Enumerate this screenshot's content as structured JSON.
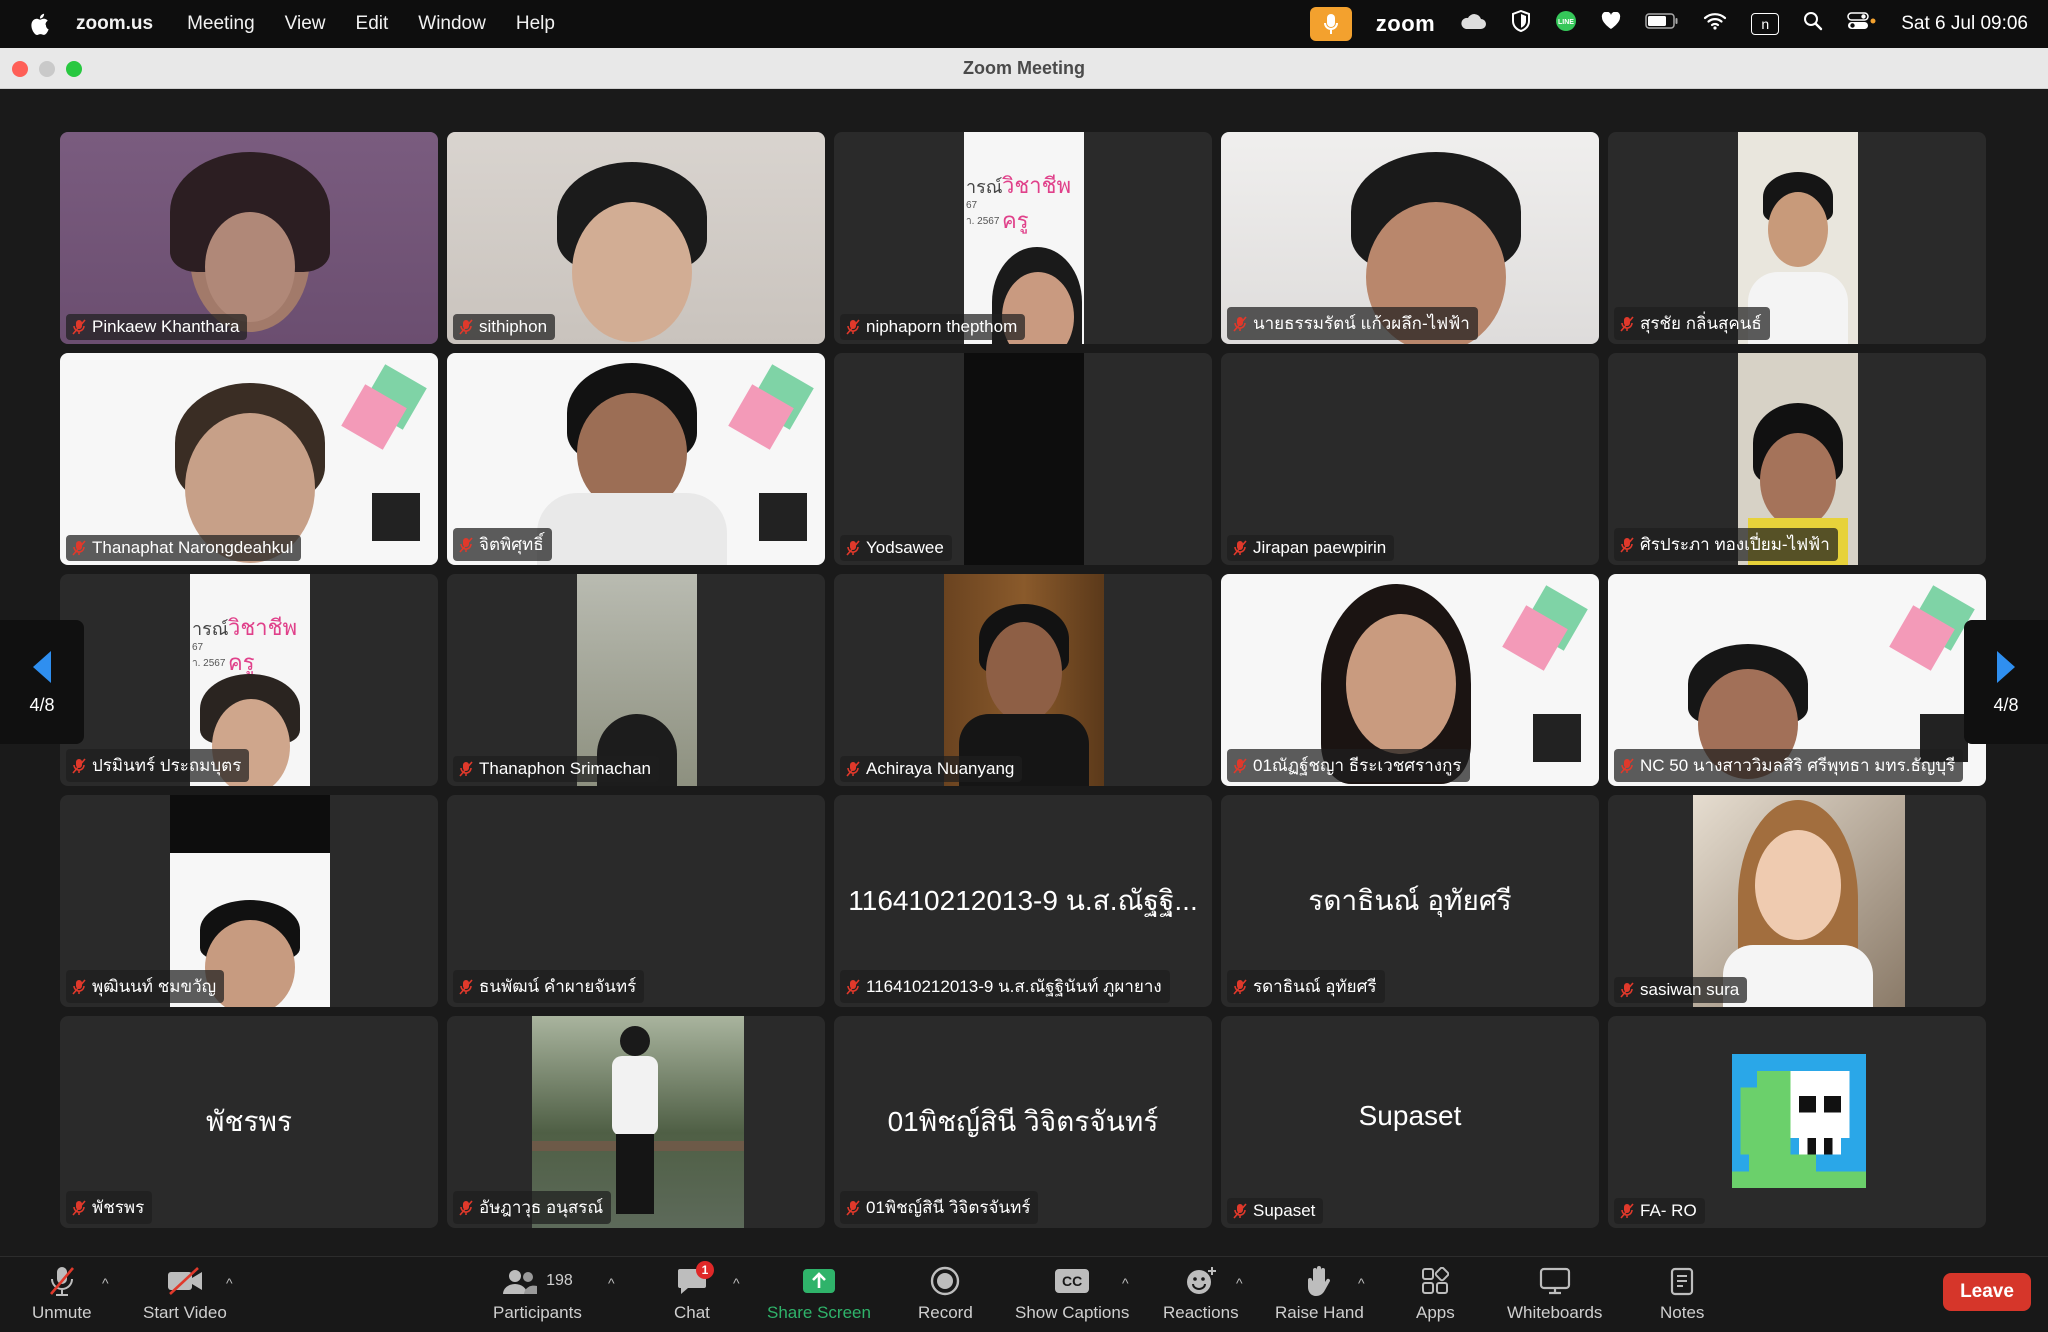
{
  "menubar": {
    "app": "zoom.us",
    "items": [
      "Meeting",
      "View",
      "Edit",
      "Window",
      "Help"
    ],
    "zoom_label": "zoom",
    "datetime": "Sat 6 Jul  09:06",
    "n_label": "n"
  },
  "window": {
    "title": "Zoom Meeting"
  },
  "pager": {
    "label": "4/8"
  },
  "participants": [
    {
      "name": "Pinkaew Khanthara"
    },
    {
      "name": "sithiphon"
    },
    {
      "name": "niphaporn thepthom"
    },
    {
      "name": "นายธรรมรัตน์ แก้วผลึก-ไฟฟ้า"
    },
    {
      "name": "สุรชัย กลิ่นสุคนธ์"
    },
    {
      "name": "Thanaphat Narongdeahkul"
    },
    {
      "name": "จิตพิศุทธิ์"
    },
    {
      "name": "Yodsawee"
    },
    {
      "name": "Jirapan paewpirin"
    },
    {
      "name": "ศิรประภา ทองเปี่ยม-ไฟฟ้า"
    },
    {
      "name": "ปรมินทร์ ประถมบุตร"
    },
    {
      "name": "Thanaphon Srimachan"
    },
    {
      "name": "Achiraya Nuanyang"
    },
    {
      "name": "01ณัฏฐ์ชญา ธีระเวชศรางกูร"
    },
    {
      "name": "NC 50 นางสาววิมลสิริ ศรีพุทธา มทร.ธัญบุรี"
    },
    {
      "name": "พุฒินนท์ ชมขวัญ"
    },
    {
      "name": "ธนพัฒน์ คำผายจันทร์"
    },
    {
      "name": "116410212013-9 น.ส.ณัฐฐินันท์ ภูผายาง",
      "display": "116410212013-9 น.ส.ณัฐฐิ..."
    },
    {
      "name": "รดาธินณ์ อุทัยศรี",
      "display": "รดาธินณ์ อุทัยศรี"
    },
    {
      "name": "sasiwan sura"
    },
    {
      "name": "พัชรพร",
      "display": "พัชรพร"
    },
    {
      "name": "อัษฎาวุธ อนุสรณ์"
    },
    {
      "name": "01พิชญ์สินี วิจิตรจันทร์",
      "display": "01พิชญ์สินี วิจิตรจันทร์"
    },
    {
      "name": "Supaset",
      "display": "Supaset"
    },
    {
      "name": "FA- RO"
    }
  ],
  "slide_text": {
    "left": "ารณ์",
    "right": "วิชาชีพครู",
    "line1": "67",
    "line2": "า. 2567"
  },
  "toolbar": {
    "unmute": "Unmute",
    "start_video": "Start Video",
    "participants": "Participants",
    "participants_count": "198",
    "chat": "Chat",
    "chat_badge": "1",
    "share_screen": "Share Screen",
    "record": "Record",
    "show_captions": "Show Captions",
    "captions_icon": "CC",
    "reactions": "Reactions",
    "raise_hand": "Raise Hand",
    "apps": "Apps",
    "whiteboards": "Whiteboards",
    "notes": "Notes",
    "leave": "Leave"
  },
  "colors": {
    "accent_green": "#2fb36a",
    "leave_red": "#d6362a",
    "mute_red": "#e0392b",
    "pager_blue": "#2f8ff0"
  }
}
